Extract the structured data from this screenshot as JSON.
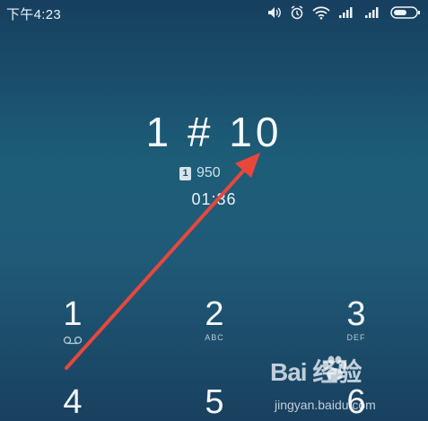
{
  "status_bar": {
    "time": "下午4:23",
    "icons": [
      "volume-icon",
      "alarm-icon",
      "wifi-icon",
      "signal-icon",
      "signal-icon",
      "battery-icon"
    ]
  },
  "call": {
    "number": "1 # 10",
    "sim_badge": "1",
    "sim_label": "950",
    "duration": "01:36"
  },
  "keypad": [
    {
      "digit": "1",
      "letters": ""
    },
    {
      "digit": "2",
      "letters": "ABC"
    },
    {
      "digit": "3",
      "letters": "DEF"
    },
    {
      "digit": "4",
      "letters": ""
    },
    {
      "digit": "5",
      "letters": ""
    },
    {
      "digit": "6",
      "letters": ""
    }
  ],
  "watermark": {
    "brand": "Bai  经验",
    "sub": "jingyan.baidu.com"
  },
  "colors": {
    "background_top": "#173f5f",
    "background_mid": "#1d5d78",
    "arrow": "#e8473c"
  }
}
